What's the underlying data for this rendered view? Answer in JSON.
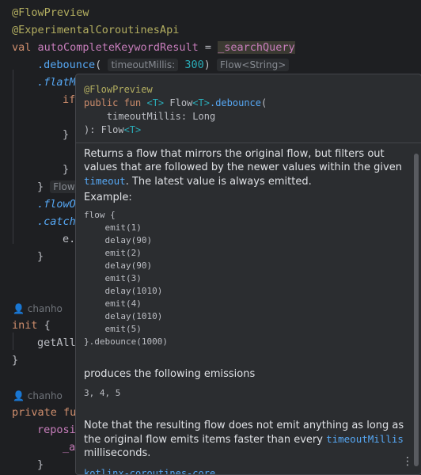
{
  "code": {
    "l1": "@FlowPreview",
    "l2": "@ExperimentalCoroutinesApi",
    "l3_kw": "val ",
    "l3_name": "autoCompleteKeywordResult",
    "l3_eq": " = ",
    "l3_src": "_searchQuery",
    "l4_fn": ".debounce",
    "l4_paren": "(",
    "l4_hint_label": "timeoutMillis:",
    "l4_num": "300",
    "l4_close": ")",
    "l4_type_hint": "Flow<String>",
    "l5_fn": ".flatM",
    "l6_kw": "if",
    "l7": "}",
    "l8": "}",
    "l9": "}",
    "l9_hint": "Flow<",
    "l10_fn": ".flowO",
    "l11_fn": ".catch",
    "l12": "e.",
    "l13": "}",
    "author1": "chanho",
    "init_kw": "init",
    "init_brace": " {",
    "init_call": "getAll",
    "init_close": "}",
    "author2": "chanho",
    "priv_kw": "private fu",
    "repo": "reposi",
    "under": "_a",
    "last_brace": "}"
  },
  "popup": {
    "sig_ann": "@FlowPreview",
    "sig_line2_kw": "public fun ",
    "sig_line2_t": "<T>",
    "sig_line2_mid": " Flow",
    "sig_line2_t2": "<T>",
    "sig_line2_fn": ".debounce",
    "sig_line2_end": "(",
    "sig_line3": "    timeoutMillis: Long",
    "sig_line4": "): Flow",
    "sig_line4_t": "<T>",
    "desc_a": "Returns a flow that mirrors the original flow, but filters out values that are followed by the newer values within the given ",
    "desc_link": "timeout",
    "desc_b": ". The latest value is always emitted.",
    "example_label": "Example:",
    "example_code": "flow {\n    emit(1)\n    delay(90)\n    emit(2)\n    delay(90)\n    emit(3)\n    delay(1010)\n    emit(4)\n    delay(1010)\n    emit(5)\n}.debounce(1000)",
    "produces": "produces the following emissions",
    "emissions": "3, 4, 5",
    "note_a": "Note that the resulting flow does not emit anything as long as the original flow emits items faster than every ",
    "note_link": "timeoutMillis",
    "note_b": " milliseconds.",
    "bottom_link": "kotlinx-coroutines-core",
    "more_icon": "⋮"
  }
}
